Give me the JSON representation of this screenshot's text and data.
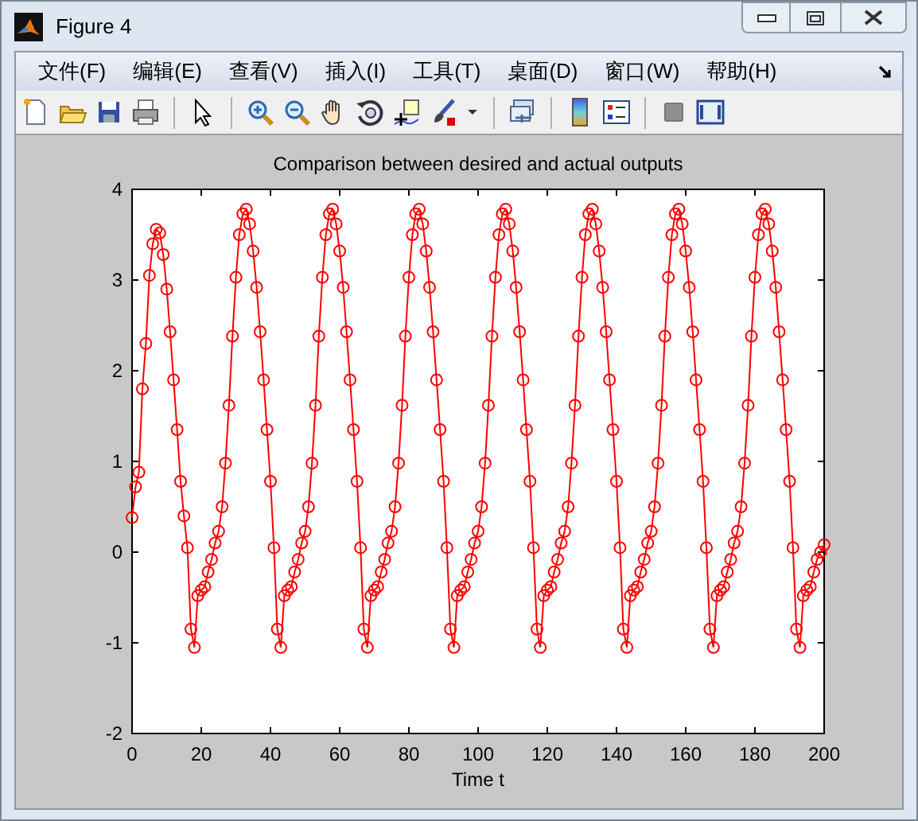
{
  "window": {
    "title": "Figure 4"
  },
  "menu": [
    "文件(F)",
    "编辑(E)",
    "查看(V)",
    "插入(I)",
    "工具(T)",
    "桌面(D)",
    "窗口(W)",
    "帮助(H)"
  ],
  "plot": {
    "chart_data": {
      "type": "line",
      "title": "Comparison between desired and actual outputs",
      "xlabel": "Time t",
      "xlim": [
        0,
        200
      ],
      "ylim": [
        -2,
        4
      ],
      "xticks": [
        0,
        20,
        40,
        60,
        80,
        100,
        120,
        140,
        160,
        180,
        200
      ],
      "yticks": [
        -2,
        -1,
        0,
        1,
        2,
        3,
        4
      ],
      "x": [
        0,
        1,
        2,
        3,
        4,
        5,
        6,
        7,
        8,
        9,
        10,
        11,
        12,
        13,
        14,
        15,
        16,
        17,
        18,
        19,
        20,
        21,
        22,
        23,
        24,
        25,
        26,
        27,
        28,
        29,
        30,
        31,
        32,
        33,
        34,
        35,
        36,
        37,
        38,
        39,
        40,
        41,
        42,
        43,
        44,
        45,
        46,
        47,
        48,
        49,
        50,
        51,
        52,
        53,
        54,
        55,
        56,
        57,
        58,
        59,
        60,
        61,
        62,
        63,
        64,
        65,
        66,
        67,
        68,
        69,
        70,
        71,
        72,
        73,
        74,
        75,
        76,
        77,
        78,
        79,
        80,
        81,
        82,
        83,
        84,
        85,
        86,
        87,
        88,
        89,
        90,
        91,
        92,
        93,
        94,
        95,
        96,
        97,
        98,
        99,
        100,
        101,
        102,
        103,
        104,
        105,
        106,
        107,
        108,
        109,
        110,
        111,
        112,
        113,
        114,
        115,
        116,
        117,
        118,
        119,
        120,
        121,
        122,
        123,
        124,
        125,
        126,
        127,
        128,
        129,
        130,
        131,
        132,
        133,
        134,
        135,
        136,
        137,
        138,
        139,
        140,
        141,
        142,
        143,
        144,
        145,
        146,
        147,
        148,
        149,
        150,
        151,
        152,
        153,
        154,
        155,
        156,
        157,
        158,
        159,
        160,
        161,
        162,
        163,
        164,
        165,
        166,
        167,
        168,
        169,
        170,
        171,
        172,
        173,
        174,
        175,
        176,
        177,
        178,
        179,
        180,
        181,
        182,
        183,
        184,
        185,
        186,
        187,
        188,
        189,
        190,
        191,
        192,
        193,
        194,
        195,
        196,
        197,
        198,
        199,
        200
      ],
      "series": [
        {
          "color": "#ff0000",
          "marker": "o",
          "values": [
            0.38,
            0.72,
            0.88,
            1.8,
            2.3,
            3.05,
            3.4,
            3.56,
            3.52,
            3.28,
            2.9,
            2.43,
            1.9,
            1.35,
            0.78,
            0.4,
            0.05,
            -0.85,
            -1.05,
            -0.48,
            -0.42,
            -0.38,
            -0.22,
            -0.08,
            0.1,
            0.23,
            0.5,
            0.98,
            1.62,
            2.38,
            3.03,
            3.5,
            3.73,
            3.78,
            3.62,
            3.32,
            2.92,
            2.43,
            1.9,
            1.35,
            0.78,
            0.05,
            -0.85,
            -1.05,
            -0.48,
            -0.42,
            -0.38,
            -0.22,
            -0.08,
            0.1,
            0.23,
            0.5,
            0.98,
            1.62,
            2.38,
            3.03,
            3.5,
            3.73,
            3.78,
            3.62,
            3.32,
            2.92,
            2.43,
            1.9,
            1.35,
            0.78,
            0.05,
            -0.85,
            -1.05,
            -0.48,
            -0.42,
            -0.38,
            -0.22,
            -0.08,
            0.1,
            0.23,
            0.5,
            0.98,
            1.62,
            2.38,
            3.03,
            3.5,
            3.73,
            3.78,
            3.62,
            3.32,
            2.92,
            2.43,
            1.9,
            1.35,
            0.78,
            0.05,
            -0.85,
            -1.05,
            -0.48,
            -0.42,
            -0.38,
            -0.22,
            -0.08,
            0.1,
            0.23,
            0.5,
            0.98,
            1.62,
            2.38,
            3.03,
            3.5,
            3.73,
            3.78,
            3.62,
            3.32,
            2.92,
            2.43,
            1.9,
            1.35,
            0.78,
            0.05,
            -0.85,
            -1.05,
            -0.48,
            -0.42,
            -0.38,
            -0.22,
            -0.08,
            0.1,
            0.23,
            0.5,
            0.98,
            1.62,
            2.38,
            3.03,
            3.5,
            3.73,
            3.78,
            3.62,
            3.32,
            2.92,
            2.43,
            1.9,
            1.35,
            0.78,
            0.05,
            -0.85,
            -1.05,
            -0.48,
            -0.42,
            -0.38,
            -0.22,
            -0.08,
            0.1,
            0.23,
            0.5,
            0.98,
            1.62,
            2.38,
            3.03,
            3.5,
            3.73,
            3.78,
            3.62,
            3.32,
            2.92,
            2.43,
            1.9,
            1.35,
            0.78,
            0.05,
            -0.85,
            -1.05,
            -0.48,
            -0.42,
            -0.38,
            -0.22,
            -0.08,
            0.1,
            0.23,
            0.5,
            0.98,
            1.62,
            2.38,
            3.03,
            3.5,
            3.73,
            3.78,
            3.62,
            3.32,
            2.92,
            2.43,
            1.9,
            1.35,
            0.78,
            0.05,
            -0.85,
            -1.05,
            -0.48,
            -0.42,
            -0.38,
            -0.22,
            -0.08,
            0.0,
            0.08
          ]
        }
      ]
    }
  }
}
